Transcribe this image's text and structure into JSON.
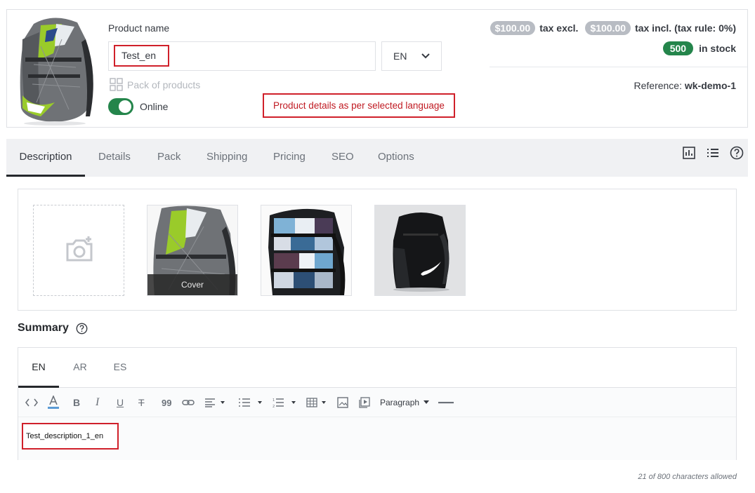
{
  "header": {
    "product_name_label": "Product name",
    "product_name_value": "Test_en",
    "language": "EN",
    "pack_label": "Pack of products",
    "online_label": "Online",
    "note": "Product details as per selected language",
    "price_excl": "$100.00",
    "tax_excl_label": "tax excl.",
    "price_incl": "$100.00",
    "tax_incl_label": "tax incl. (tax rule: 0%)",
    "stock_qty": "500",
    "stock_label": "in stock",
    "reference_label": "Reference:",
    "reference_value": "wk-demo-1"
  },
  "tabs": [
    {
      "label": "Description",
      "active": true
    },
    {
      "label": "Details"
    },
    {
      "label": "Pack"
    },
    {
      "label": "Shipping"
    },
    {
      "label": "Pricing"
    },
    {
      "label": "SEO"
    },
    {
      "label": "Options"
    }
  ],
  "tab_icons": [
    "bar-chart-icon",
    "list-icon",
    "help-circle-icon"
  ],
  "images": {
    "cover_label": "Cover",
    "items": [
      "add-image-icon",
      "green-grey-backpack",
      "patterned-backpack",
      "black-nike-backpack"
    ]
  },
  "summary": {
    "title": "Summary",
    "lang_tabs": [
      {
        "label": "EN",
        "active": true
      },
      {
        "label": "AR"
      },
      {
        "label": "ES"
      }
    ],
    "toolbar": {
      "paragraph_label": "Paragraph"
    },
    "content": "Test_description_1_en",
    "counter": "21 of 800 characters allowed"
  },
  "colors": {
    "accent_green": "#24854b",
    "highlight_red": "#d0202a",
    "pill_grey": "#b8bcc3"
  }
}
